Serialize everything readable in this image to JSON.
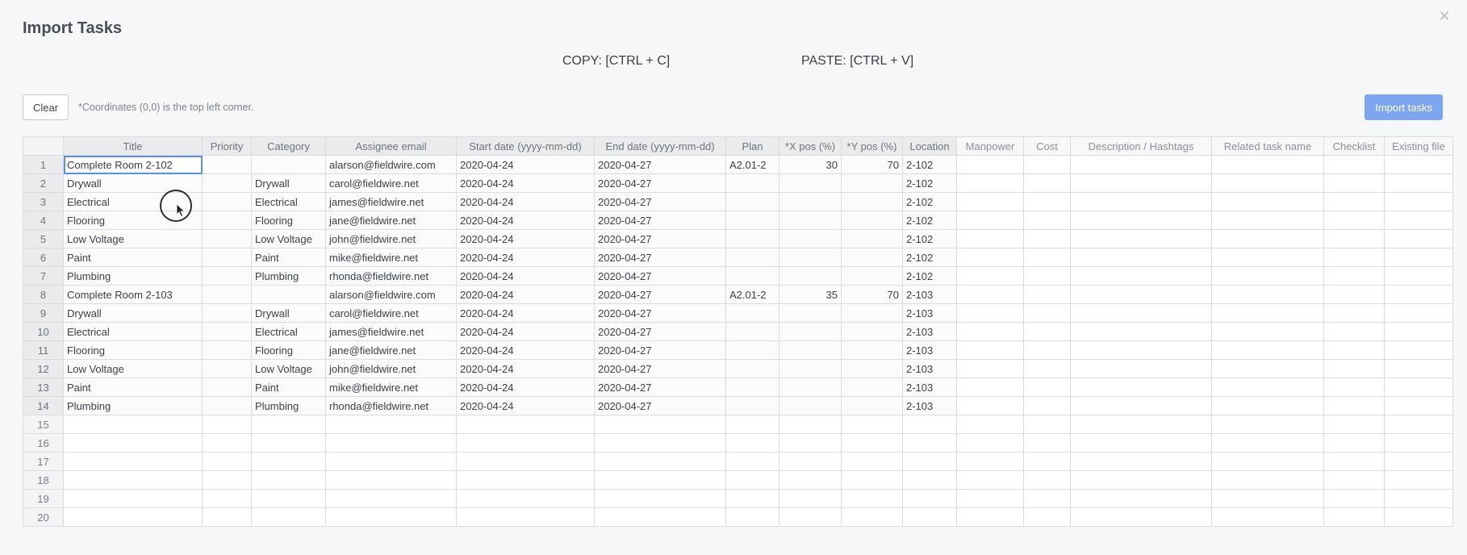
{
  "modal": {
    "title": "Import Tasks",
    "close_icon": "close-icon",
    "copy_hint": "COPY: [CTRL + C]",
    "paste_hint": "PASTE: [CTRL + V]",
    "clear_label": "Clear",
    "coord_note": "*Coordinates (0,0) is the top left corner.",
    "import_label": "Import tasks",
    "accent_color": "#7ea6ee"
  },
  "grid": {
    "columns": [
      "Title",
      "Priority",
      "Category",
      "Assignee email",
      "Start date (yyyy-mm-dd)",
      "End date (yyyy-mm-dd)",
      "Plan",
      "*X pos (%)",
      "*Y pos (%)",
      "Location",
      "Manpower",
      "Cost",
      "Description / Hashtags",
      "Related task name",
      "Checklist",
      "Existing file"
    ],
    "rows": [
      [
        "1",
        "Complete Room 2-102",
        "",
        "",
        "alarson@fieldwire.com",
        "2020-04-24",
        "2020-04-27",
        "A2.01-2",
        "30",
        "70",
        "2-102",
        "",
        "",
        "",
        "",
        "",
        ""
      ],
      [
        "2",
        "Drywall",
        "",
        "Drywall",
        "carol@fieldwire.net",
        "2020-04-24",
        "2020-04-27",
        "",
        "",
        "",
        "2-102",
        "",
        "",
        "",
        "",
        "",
        ""
      ],
      [
        "3",
        "Electrical",
        "",
        "Electrical",
        "james@fieldwire.net",
        "2020-04-24",
        "2020-04-27",
        "",
        "",
        "",
        "2-102",
        "",
        "",
        "",
        "",
        "",
        ""
      ],
      [
        "4",
        "Flooring",
        "",
        "Flooring",
        "jane@fieldwire.net",
        "2020-04-24",
        "2020-04-27",
        "",
        "",
        "",
        "2-102",
        "",
        "",
        "",
        "",
        "",
        ""
      ],
      [
        "5",
        "Low Voltage",
        "",
        "Low Voltage",
        "john@fieldwire.net",
        "2020-04-24",
        "2020-04-27",
        "",
        "",
        "",
        "2-102",
        "",
        "",
        "",
        "",
        "",
        ""
      ],
      [
        "6",
        "Paint",
        "",
        "Paint",
        "mike@fieldwire.net",
        "2020-04-24",
        "2020-04-27",
        "",
        "",
        "",
        "2-102",
        "",
        "",
        "",
        "",
        "",
        ""
      ],
      [
        "7",
        "Plumbing",
        "",
        "Plumbing",
        "rhonda@fieldwire.net",
        "2020-04-24",
        "2020-04-27",
        "",
        "",
        "",
        "2-102",
        "",
        "",
        "",
        "",
        "",
        ""
      ],
      [
        "8",
        "Complete Room 2-103",
        "",
        "",
        "alarson@fieldwire.com",
        "2020-04-24",
        "2020-04-27",
        "A2.01-2",
        "35",
        "70",
        "2-103",
        "",
        "",
        "",
        "",
        "",
        ""
      ],
      [
        "9",
        "Drywall",
        "",
        "Drywall",
        "carol@fieldwire.net",
        "2020-04-24",
        "2020-04-27",
        "",
        "",
        "",
        "2-103",
        "",
        "",
        "",
        "",
        "",
        ""
      ],
      [
        "10",
        "Electrical",
        "",
        "Electrical",
        "james@fieldwire.net",
        "2020-04-24",
        "2020-04-27",
        "",
        "",
        "",
        "2-103",
        "",
        "",
        "",
        "",
        "",
        ""
      ],
      [
        "11",
        "Flooring",
        "",
        "Flooring",
        "jane@fieldwire.net",
        "2020-04-24",
        "2020-04-27",
        "",
        "",
        "",
        "2-103",
        "",
        "",
        "",
        "",
        "",
        ""
      ],
      [
        "12",
        "Low Voltage",
        "",
        "Low Voltage",
        "john@fieldwire.net",
        "2020-04-24",
        "2020-04-27",
        "",
        "",
        "",
        "2-103",
        "",
        "",
        "",
        "",
        "",
        ""
      ],
      [
        "13",
        "Paint",
        "",
        "Paint",
        "mike@fieldwire.net",
        "2020-04-24",
        "2020-04-27",
        "",
        "",
        "",
        "2-103",
        "",
        "",
        "",
        "",
        "",
        ""
      ],
      [
        "14",
        "Plumbing",
        "",
        "Plumbing",
        "rhonda@fieldwire.net",
        "2020-04-24",
        "2020-04-27",
        "",
        "",
        "",
        "2-103",
        "",
        "",
        "",
        "",
        "",
        ""
      ],
      [
        "15",
        "",
        "",
        "",
        "",
        "",
        "",
        "",
        "",
        "",
        "",
        "",
        "",
        "",
        "",
        "",
        ""
      ],
      [
        "16",
        "",
        "",
        "",
        "",
        "",
        "",
        "",
        "",
        "",
        "",
        "",
        "",
        "",
        "",
        "",
        ""
      ],
      [
        "17",
        "",
        "",
        "",
        "",
        "",
        "",
        "",
        "",
        "",
        "",
        "",
        "",
        "",
        "",
        "",
        ""
      ],
      [
        "18",
        "",
        "",
        "",
        "",
        "",
        "",
        "",
        "",
        "",
        "",
        "",
        "",
        "",
        "",
        "",
        ""
      ],
      [
        "19",
        "",
        "",
        "",
        "",
        "",
        "",
        "",
        "",
        "",
        "",
        "",
        "",
        "",
        "",
        "",
        ""
      ],
      [
        "20",
        "",
        "",
        "",
        "",
        "",
        "",
        "",
        "",
        "",
        "",
        "",
        "",
        "",
        "",
        "",
        ""
      ]
    ]
  }
}
